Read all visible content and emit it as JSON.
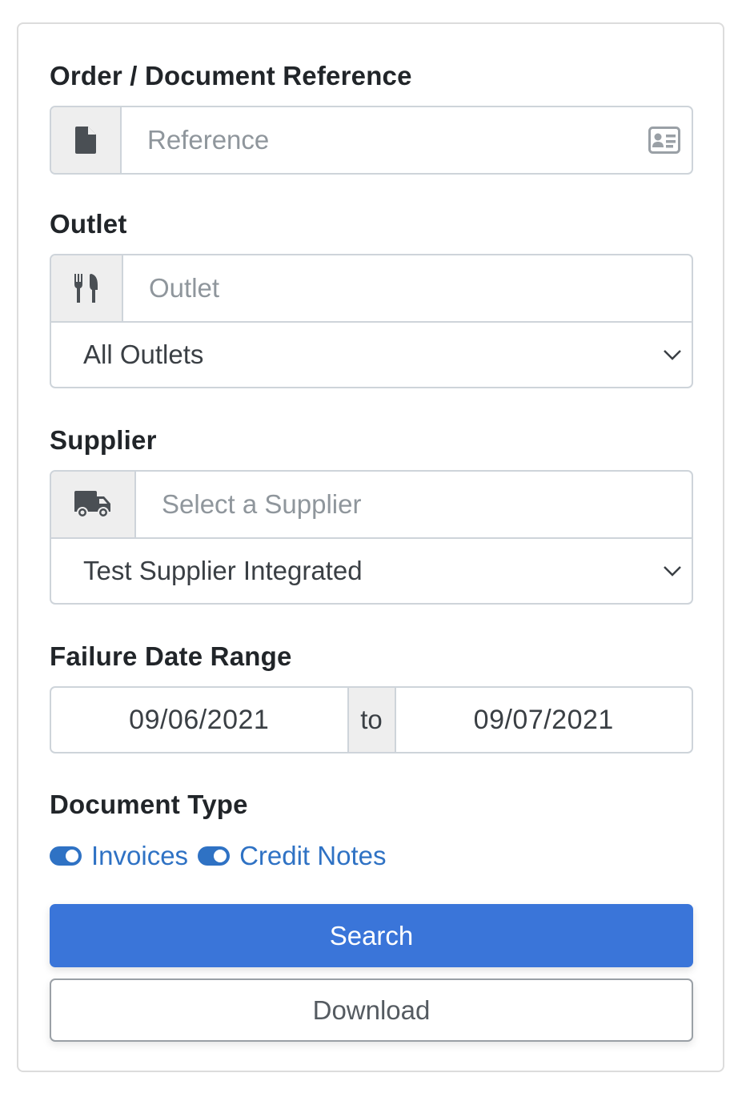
{
  "reference": {
    "label": "Order / Document Reference",
    "placeholder": "Reference",
    "icon": "file-icon",
    "trailing_icon": "id-card-icon"
  },
  "outlet": {
    "label": "Outlet",
    "placeholder": "Outlet",
    "icon": "utensils-icon",
    "selected": "All Outlets"
  },
  "supplier": {
    "label": "Supplier",
    "placeholder": "Select a Supplier",
    "icon": "truck-icon",
    "selected": "Test Supplier Integrated"
  },
  "date_range": {
    "label": "Failure Date Range",
    "from": "09/06/2021",
    "separator": "to",
    "to": "09/07/2021"
  },
  "document_type": {
    "label": "Document Type",
    "options": [
      {
        "label": "Invoices",
        "checked": true
      },
      {
        "label": "Credit Notes",
        "checked": true
      }
    ]
  },
  "actions": {
    "search": "Search",
    "download": "Download"
  },
  "colors": {
    "primary": "#3a75d9",
    "toggle": "#2f72c4",
    "addon_bg": "#eeeeee",
    "border": "#ced4da"
  }
}
